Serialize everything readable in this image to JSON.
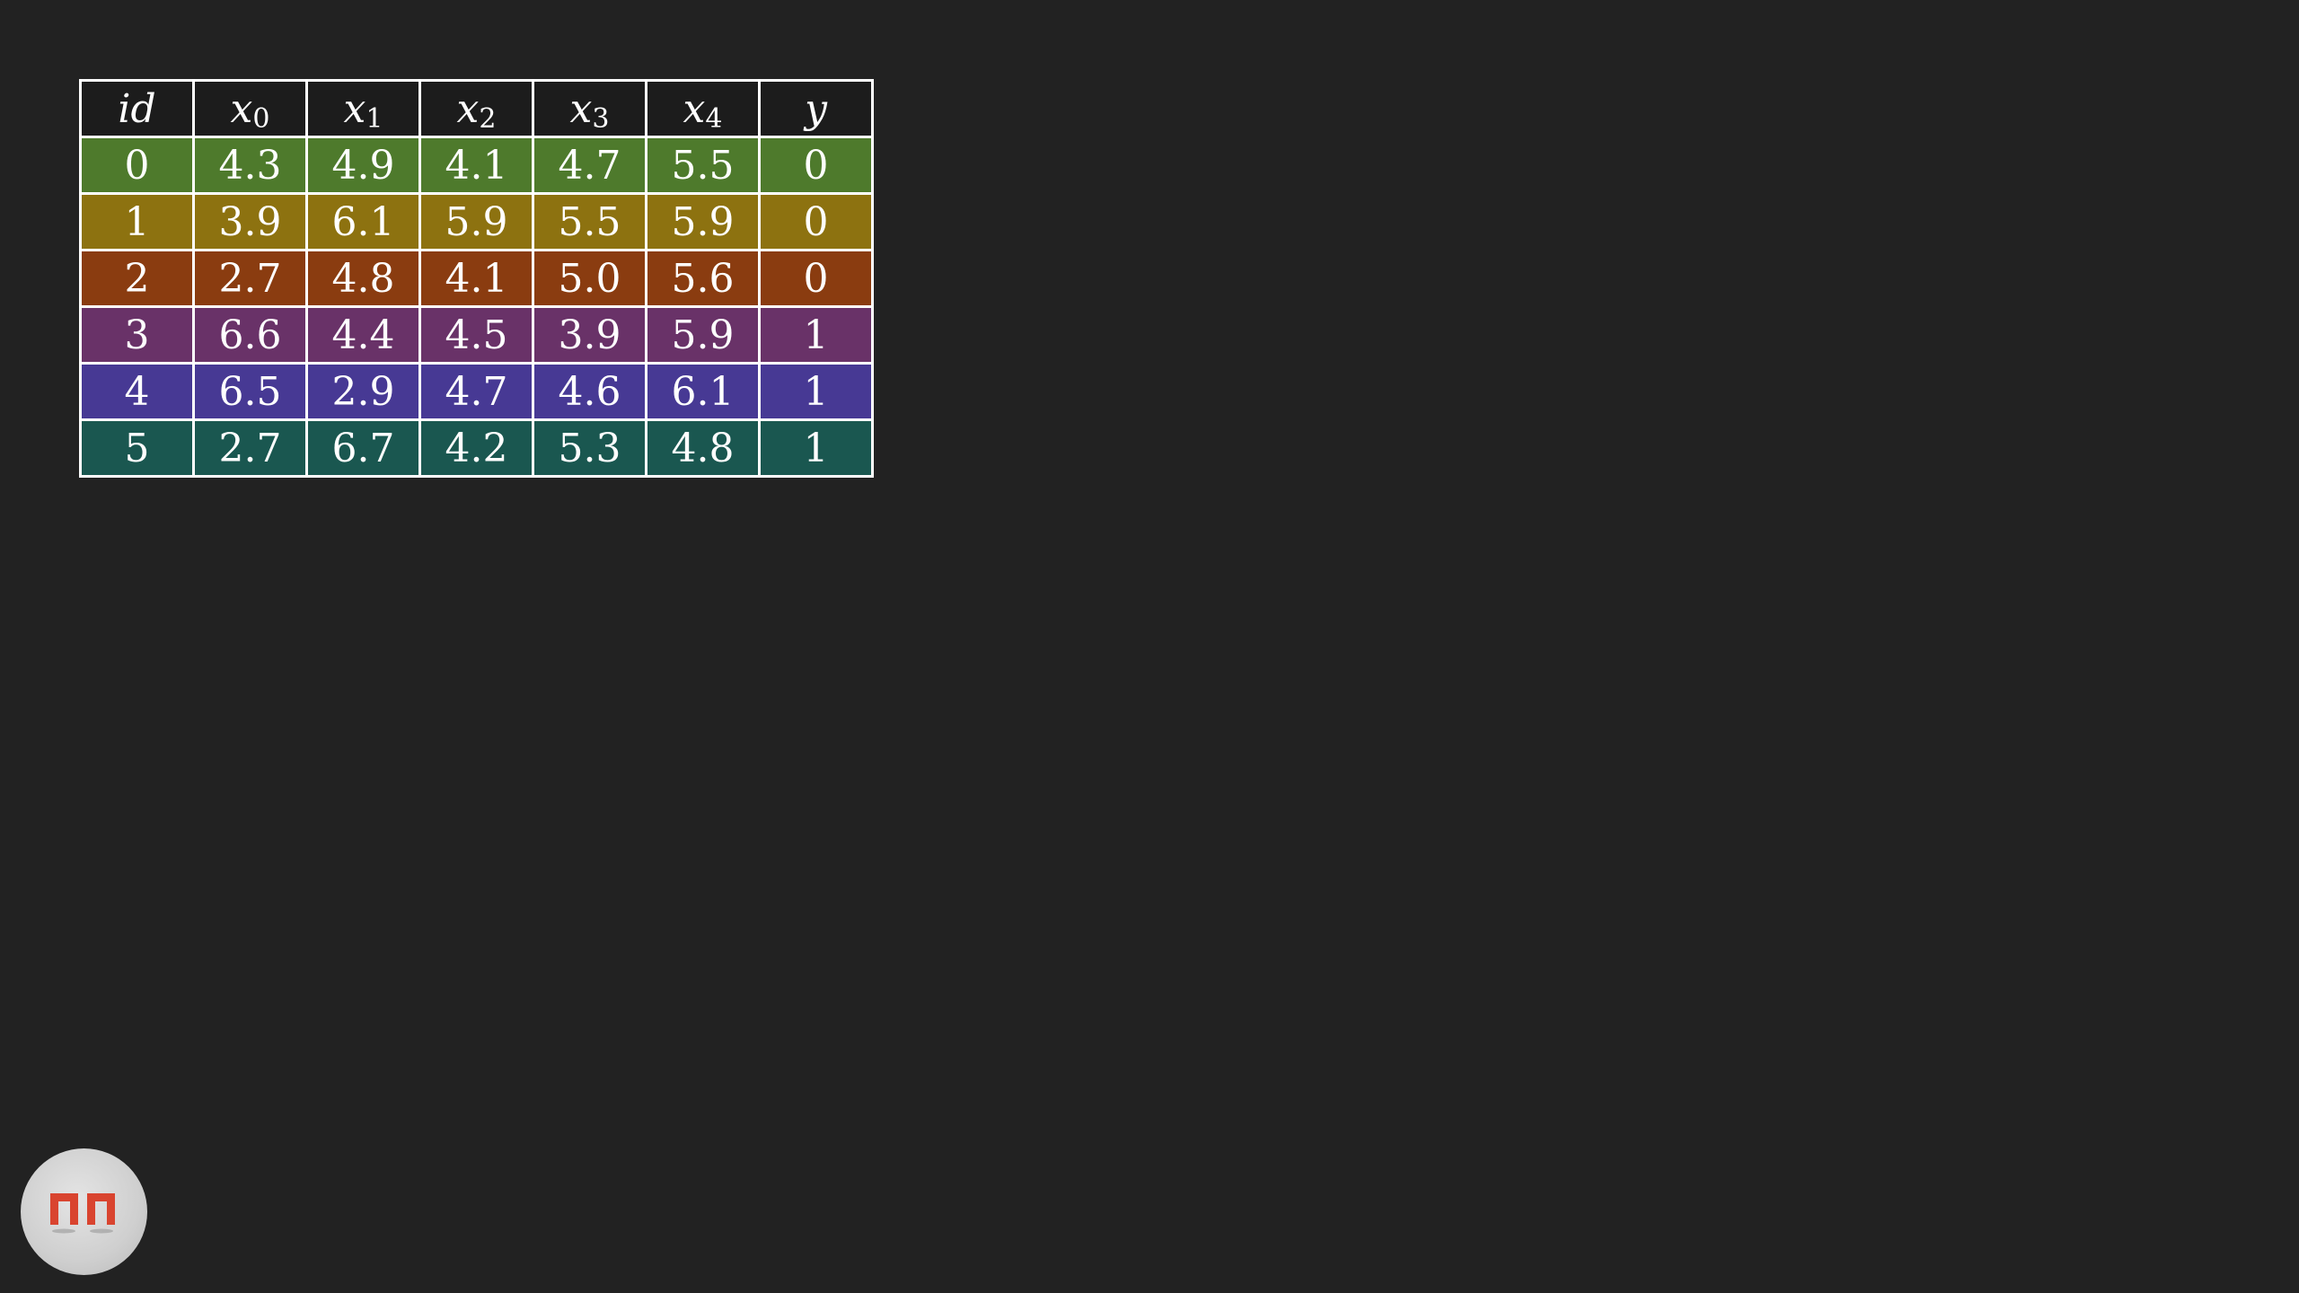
{
  "table": {
    "columns": [
      {
        "base": "id",
        "sub": ""
      },
      {
        "base": "x",
        "sub": "0"
      },
      {
        "base": "x",
        "sub": "1"
      },
      {
        "base": "x",
        "sub": "2"
      },
      {
        "base": "x",
        "sub": "3"
      },
      {
        "base": "x",
        "sub": "4"
      },
      {
        "base": "y",
        "sub": ""
      }
    ],
    "rows": [
      {
        "color": "#4e7a2c",
        "cells": [
          "0",
          "4.3",
          "4.9",
          "4.1",
          "4.7",
          "5.5",
          "0"
        ]
      },
      {
        "color": "#8d7210",
        "cells": [
          "1",
          "3.9",
          "6.1",
          "5.9",
          "5.5",
          "5.9",
          "0"
        ]
      },
      {
        "color": "#8a3c10",
        "cells": [
          "2",
          "2.7",
          "4.8",
          "4.1",
          "5.0",
          "5.6",
          "0"
        ]
      },
      {
        "color": "#693268",
        "cells": [
          "3",
          "6.6",
          "4.4",
          "4.5",
          "3.9",
          "5.9",
          "1"
        ]
      },
      {
        "color": "#473994",
        "cells": [
          "4",
          "6.5",
          "2.9",
          "4.7",
          "4.6",
          "6.1",
          "1"
        ]
      },
      {
        "color": "#1a5750",
        "cells": [
          "5",
          "2.7",
          "6.7",
          "4.2",
          "5.3",
          "4.8",
          "1"
        ]
      }
    ]
  },
  "logo": {
    "icon": "nn-logo-icon",
    "accent_color": "#d9442f"
  }
}
